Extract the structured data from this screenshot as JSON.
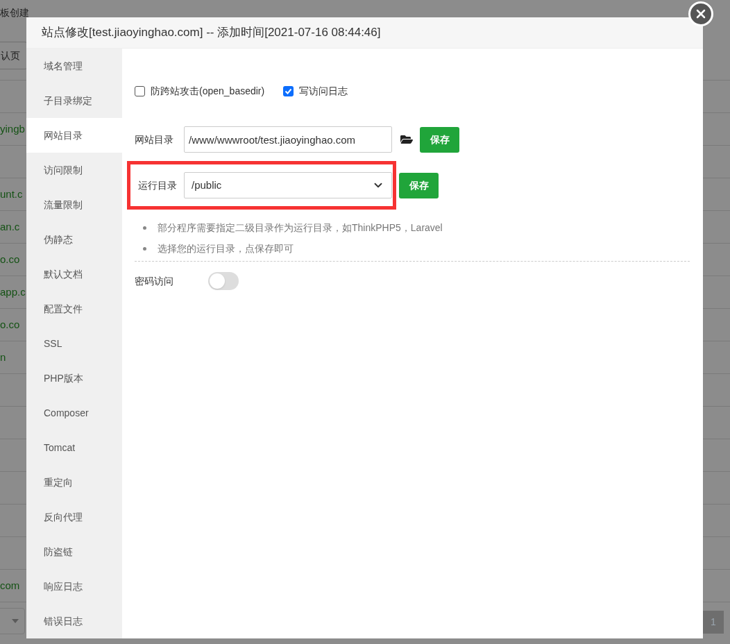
{
  "background_page": {
    "notice": "板创建",
    "button": "认页",
    "rows": [
      "",
      "yingb",
      "",
      "unt.c",
      "an.c",
      "o.co",
      "app.c",
      "o.co",
      "n",
      "",
      "",
      "",
      "",
      "",
      "",
      "com"
    ],
    "pagination": "1"
  },
  "dialog": {
    "title": "站点修改[test.jiaoyinghao.com] -- 添加时间[2021-07-16 08:44:46]",
    "sidebar": [
      {
        "label": "域名管理",
        "selected": false
      },
      {
        "label": "子目录绑定",
        "selected": false
      },
      {
        "label": "网站目录",
        "selected": true
      },
      {
        "label": "访问限制",
        "selected": false
      },
      {
        "label": "流量限制",
        "selected": false
      },
      {
        "label": "伪静态",
        "selected": false
      },
      {
        "label": "默认文档",
        "selected": false
      },
      {
        "label": "配置文件",
        "selected": false
      },
      {
        "label": "SSL",
        "selected": false
      },
      {
        "label": "PHP版本",
        "selected": false
      },
      {
        "label": "Composer",
        "selected": false
      },
      {
        "label": "Tomcat",
        "selected": false
      },
      {
        "label": "重定向",
        "selected": false
      },
      {
        "label": "反向代理",
        "selected": false
      },
      {
        "label": "防盗链",
        "selected": false
      },
      {
        "label": "响应日志",
        "selected": false
      },
      {
        "label": "错误日志",
        "selected": false
      }
    ],
    "options": [
      {
        "label": "防跨站攻击(open_basedir)",
        "checked": false
      },
      {
        "label": "写访问日志",
        "checked": true
      }
    ],
    "site_dir": {
      "label": "网站目录",
      "value": "/www/wwwroot/test.jiaoyinghao.com",
      "button": "保存"
    },
    "run_dir": {
      "label": "运行目录",
      "value": "/public",
      "button": "保存",
      "highlighted": true
    },
    "tips": [
      "部分程序需要指定二级目录作为运行目录，如ThinkPHP5，Laravel",
      "选择您的运行目录，点保存即可"
    ],
    "password_access": {
      "label": "密码访问",
      "on": false
    }
  }
}
